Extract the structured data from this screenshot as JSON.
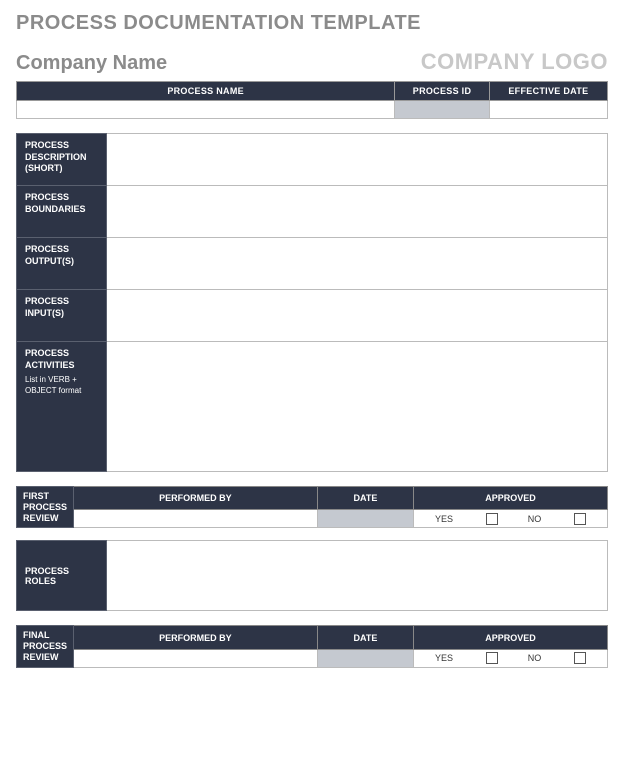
{
  "title": "PROCESS DOCUMENTATION TEMPLATE",
  "company_name": "Company Name",
  "company_logo": "COMPANY LOGO",
  "info": {
    "process_name_header": "PROCESS NAME",
    "process_id_header": "PROCESS ID",
    "effective_date_header": "EFFECTIVE DATE",
    "process_name": "",
    "process_id": "",
    "effective_date": ""
  },
  "sections": {
    "description": "PROCESS DESCRIPTION (SHORT)",
    "boundaries": "PROCESS BOUNDARIES",
    "outputs": "PROCESS OUTPUT(S)",
    "inputs": "PROCESS INPUT(S)",
    "activities": "PROCESS ACTIVITIES",
    "activities_note": "List in VERB + OBJECT format",
    "roles": "PROCESS ROLES"
  },
  "review_headers": {
    "performed_by": "PERFORMED BY",
    "date": "DATE",
    "approved": "APPROVED"
  },
  "first_review": {
    "label": "FIRST PROCESS REVIEW",
    "performed_by": "",
    "date": "",
    "yes_label": "YES",
    "no_label": "NO"
  },
  "final_review": {
    "label": "FINAL PROCESS REVIEW",
    "performed_by": "",
    "date": "",
    "yes_label": "YES",
    "no_label": "NO"
  }
}
